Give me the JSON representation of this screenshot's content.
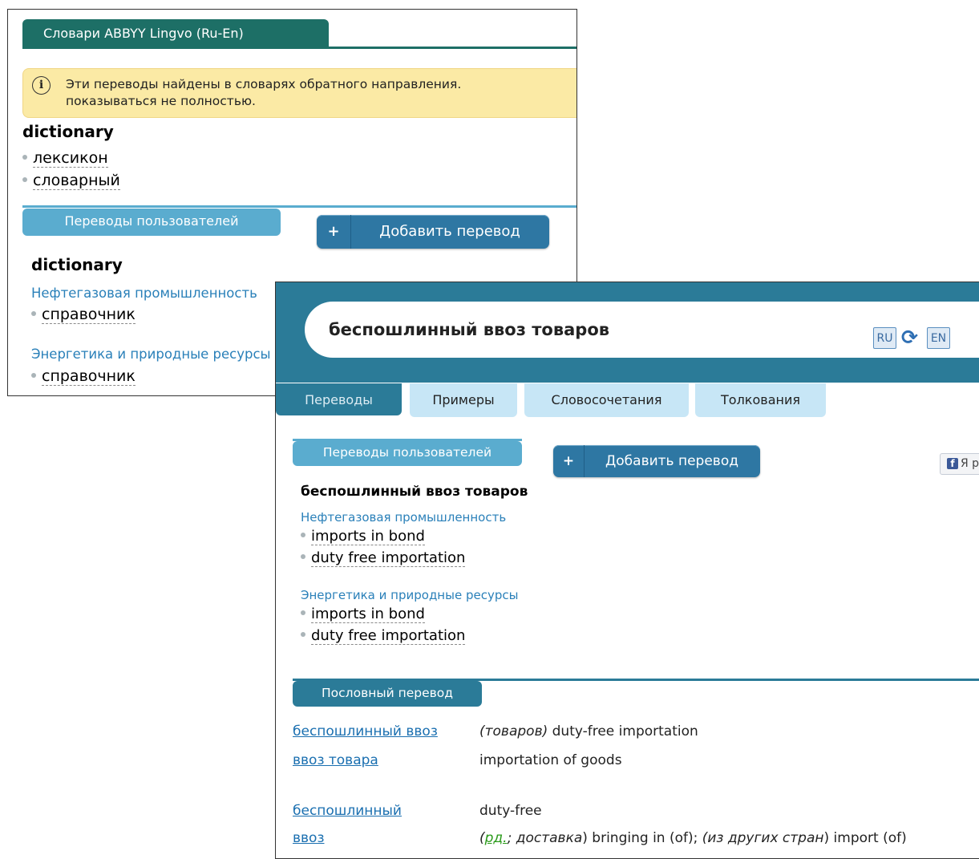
{
  "back_panel": {
    "dict_tab": "Словари ABBYY Lingvo (Ru-En)",
    "notice": {
      "line1": "Эти переводы найдены в словарях обратного направления.",
      "line2": "показываться не полностью."
    },
    "entry": {
      "headword": "dictionary",
      "items": [
        "лексикон",
        "словарный"
      ]
    },
    "user_translations": {
      "tab": "Переводы пользователей",
      "add_button": "Добавить перевод",
      "plus": "+",
      "headword": "dictionary",
      "groups": [
        {
          "subject": "Нефтегазовая промышленность",
          "items": [
            "справочник"
          ]
        },
        {
          "subject": "Энергетика и природные ресурсы",
          "items": [
            "справочник"
          ]
        }
      ]
    }
  },
  "front_panel": {
    "search_query": "беспошлинный ввоз товаров",
    "lang_from": "RU",
    "lang_to": "EN",
    "tabs": [
      "Переводы",
      "Примеры",
      "Словосочетания",
      "Толкования"
    ],
    "user_translations": {
      "tab": "Переводы пользователей",
      "add_button": "Добавить перевод",
      "plus": "+",
      "headword": "беспошлинный ввоз товаров",
      "groups": [
        {
          "subject": "Нефтегазовая промышленность",
          "items": [
            "imports in bond",
            "duty free importation"
          ]
        },
        {
          "subject": "Энергетика и природные ресурсы",
          "items": [
            "imports in bond",
            "duty free importation"
          ]
        }
      ]
    },
    "fb_button": "Я р",
    "word_translation": {
      "tab": "Пословный перевод",
      "rows": [
        {
          "term": "беспошлинный ввоз",
          "note": "(товаров)",
          "text": " duty-free importation"
        },
        {
          "term": "ввоз товара",
          "text": "importation of goods"
        },
        {
          "term": "беспошлинный",
          "text": "duty-free"
        },
        {
          "term": "ввоз",
          "abbr": "рд.",
          "note_after_abbr": "; доставка",
          "text": ") bringing in (of); ",
          "note2": "(из других стран",
          "text2": ") import (of)"
        }
      ]
    }
  }
}
